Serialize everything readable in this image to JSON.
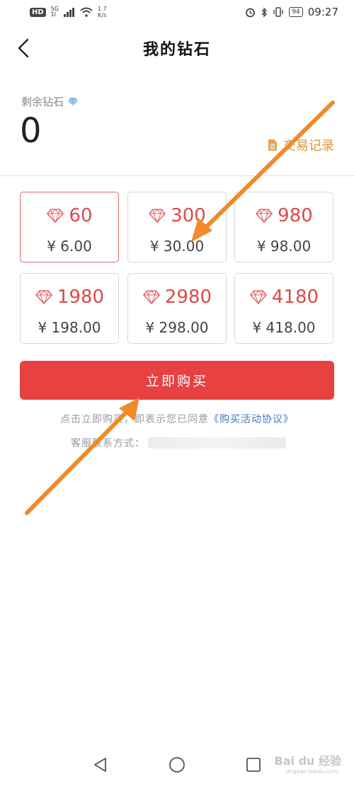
{
  "status_bar": {
    "hd": "HD",
    "net": "5G",
    "signal_sub": "1l",
    "speed_value": "1.7",
    "speed_unit": "K/s",
    "battery": "94",
    "time": "09:27"
  },
  "header": {
    "title": "我的钻石"
  },
  "balance": {
    "label": "剩余钻石",
    "value": "0",
    "record_label": "交易记录"
  },
  "packages": [
    {
      "amount": "60",
      "price": "¥ 6.00",
      "selected": true
    },
    {
      "amount": "300",
      "price": "¥ 30.00",
      "selected": false
    },
    {
      "amount": "980",
      "price": "¥ 98.00",
      "selected": false
    },
    {
      "amount": "1980",
      "price": "¥ 198.00",
      "selected": false
    },
    {
      "amount": "2980",
      "price": "¥ 298.00",
      "selected": false
    },
    {
      "amount": "4180",
      "price": "¥ 418.00",
      "selected": false
    }
  ],
  "buy_button": {
    "label": "立即购买"
  },
  "agreement": {
    "prefix": "点击立即购买，即表示您已同意",
    "link": "《购买活动协议》"
  },
  "contact": {
    "label": "客服联系方式："
  },
  "watermark": {
    "text": "Bai du 经验",
    "sub": "jingyan.baidu.com"
  },
  "colors": {
    "accent_red": "#e84141",
    "amount_red": "#dd4a4a",
    "record_gold": "#d9963b",
    "link_blue": "#3d7ac0",
    "arrow_orange": "#f08a2b"
  }
}
